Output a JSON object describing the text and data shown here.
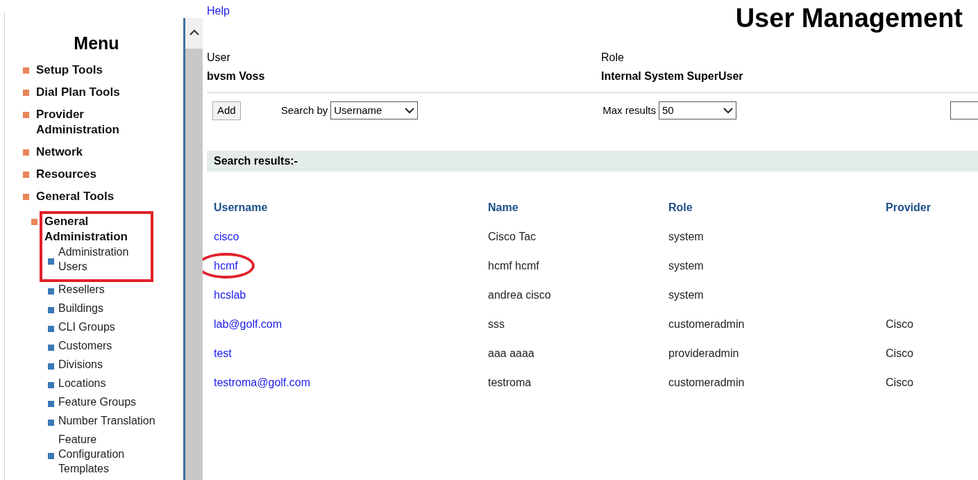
{
  "menu": {
    "title": "Menu",
    "items": [
      {
        "label": "Setup Tools",
        "highlighted": false
      },
      {
        "label": "Dial Plan Tools",
        "highlighted": false
      },
      {
        "label": "Provider Administration",
        "highlighted": false
      },
      {
        "label": "Network",
        "highlighted": false
      },
      {
        "label": "Resources",
        "highlighted": false
      },
      {
        "label": "General Tools",
        "highlighted": false
      },
      {
        "label": "General Administration",
        "highlighted": true,
        "children": [
          {
            "label": "Administration Users",
            "highlighted": true
          },
          {
            "label": "Resellers",
            "highlighted": false
          },
          {
            "label": "Buildings",
            "highlighted": false
          },
          {
            "label": "CLI Groups",
            "highlighted": false
          },
          {
            "label": "Customers",
            "highlighted": false
          },
          {
            "label": "Divisions",
            "highlighted": false
          },
          {
            "label": "Locations",
            "highlighted": false
          },
          {
            "label": "Feature Groups",
            "highlighted": false
          },
          {
            "label": "Number Translation",
            "highlighted": false
          },
          {
            "label": "Feature Configuration Templates",
            "highlighted": false
          }
        ]
      }
    ]
  },
  "help_link": "Help",
  "page_title": "User Management",
  "info": [
    {
      "label": "User",
      "value": "bvsm Voss"
    },
    {
      "label": "Role",
      "value": "Internal System SuperUser"
    }
  ],
  "toolbar": {
    "add_button": "Add",
    "search_by_label": "Search by",
    "search_by_value": "Username",
    "max_results_label": "Max results",
    "max_results_value": "50"
  },
  "results_heading": "Search results:-",
  "table": {
    "columns": [
      "Username",
      "Name",
      "Role",
      "Provider"
    ],
    "rows": [
      {
        "cells": [
          "cisco",
          "Cisco Tac",
          "system",
          ""
        ],
        "circled": false
      },
      {
        "cells": [
          "hcmf",
          "hcmf hcmf",
          "system",
          ""
        ],
        "circled": true
      },
      {
        "cells": [
          "hcslab",
          "andrea cisco",
          "system",
          ""
        ],
        "circled": false
      },
      {
        "cells": [
          "lab@golf.com",
          "sss",
          "customeradmin",
          "Cisco"
        ],
        "circled": false
      },
      {
        "cells": [
          "test",
          "aaa aaaa",
          "provideradmin",
          "Cisco"
        ],
        "circled": false
      },
      {
        "cells": [
          "testroma@golf.com",
          "testroma",
          "customeradmin",
          "Cisco"
        ],
        "circled": false
      }
    ]
  }
}
